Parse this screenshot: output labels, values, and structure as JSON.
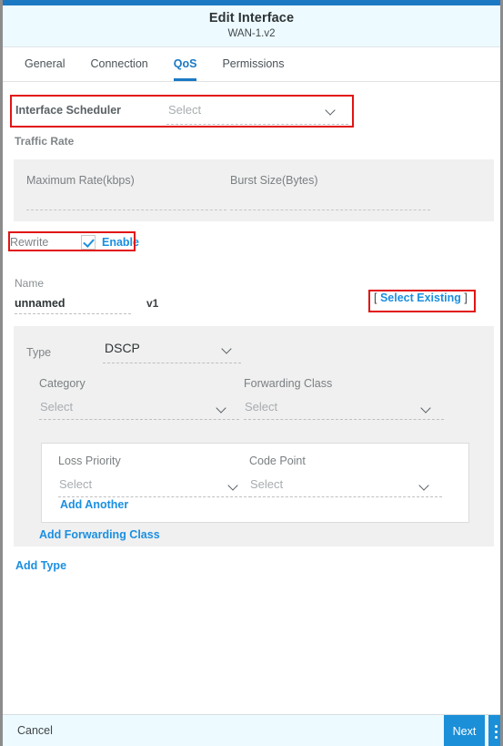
{
  "window": {
    "title": "Edit Interface",
    "subtitle": "WAN-1.v2"
  },
  "tabs": [
    {
      "label": "General",
      "active": false
    },
    {
      "label": "Connection",
      "active": false
    },
    {
      "label": "QoS",
      "active": true
    },
    {
      "label": "Permissions",
      "active": false
    }
  ],
  "scheduler": {
    "label": "Interface Scheduler",
    "value": "Select"
  },
  "traffic_rate": {
    "section_label": "Traffic Rate",
    "fields": [
      {
        "label": "Maximum Rate(kbps)",
        "value": ""
      },
      {
        "label": "Burst Size(Bytes)",
        "value": ""
      }
    ]
  },
  "rewrite": {
    "label": "Rewrite",
    "checked": true,
    "enable_label": "Enable"
  },
  "name": {
    "label": "Name",
    "value": "unnamed",
    "version": "v1",
    "select_existing": {
      "open_bracket": "[",
      "text": "Select Existing",
      "close_bracket": "]"
    }
  },
  "type_card": {
    "type_label": "Type",
    "type_value": "DSCP",
    "category": {
      "label": "Category",
      "value": "Select"
    },
    "forwarding_class": {
      "label": "Forwarding Class",
      "value": "Select"
    },
    "loss_priority": {
      "label": "Loss Priority",
      "value": "Select"
    },
    "code_point": {
      "label": "Code Point",
      "value": "Select"
    },
    "add_another_label": "Add Another",
    "add_forwarding_class_label": "Add Forwarding Class"
  },
  "add_type_label": "Add Type",
  "footer": {
    "cancel_label": "Cancel",
    "next_label": "Next",
    "kebab_icon": "more-vertical-icon"
  },
  "colors": {
    "accent_blue": "#1b79c4",
    "link_blue": "#1b8fe0",
    "button_blue": "#1b8fd8",
    "header_bg": "#edfaff",
    "panel_gray": "#f0f0f0",
    "highlight_red": "#e21414"
  }
}
